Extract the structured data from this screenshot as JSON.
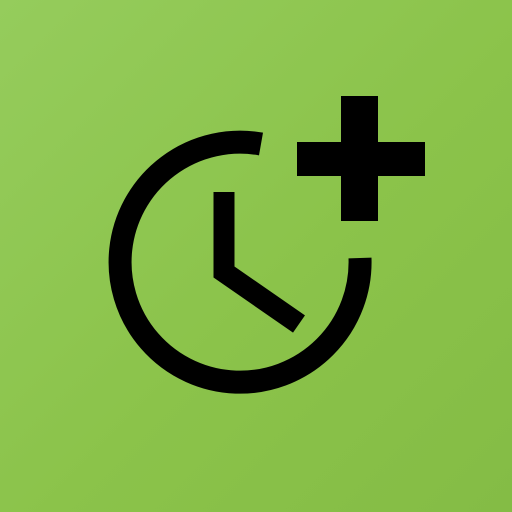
{
  "app_icon": {
    "icon_name": "alarm-add-icon",
    "colors": {
      "background": "#8bc34a",
      "glyph": "#000000"
    }
  }
}
